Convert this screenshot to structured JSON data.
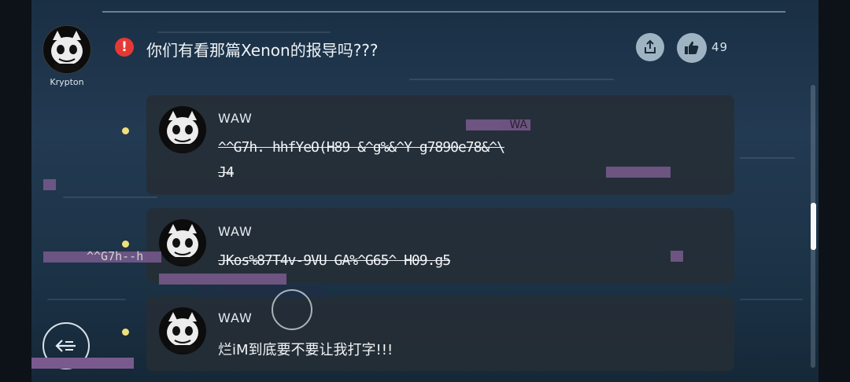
{
  "post": {
    "author": "Krypton",
    "alert_symbol": "!",
    "title": "你们有看那篇Xenon的报导吗???",
    "likes": "49",
    "share_icon": "share-icon",
    "like_icon": "thumbs-up-icon"
  },
  "replies": [
    {
      "username": "WAW",
      "text_line1": "^^G7h. hhfYeO(H89 &^g%&^Y g7890e78&^\\",
      "text_line2": "J4"
    },
    {
      "username": "WAW",
      "text_line1": "JKos%87T4v-9VU GA%^G65^ H09.g5"
    },
    {
      "username": "WAW",
      "text_line1": "烂iM到底要不要让我打字!!!"
    }
  ],
  "glitch_texts": {
    "overlay_top": "WA",
    "overlay_left": "^^G7h--h"
  },
  "colors": {
    "accent_alert": "#e53935",
    "bullet": "#f1e07a",
    "glitch": "#7a5a8e"
  },
  "nav": {
    "back_icon": "back-arrow-icon"
  }
}
